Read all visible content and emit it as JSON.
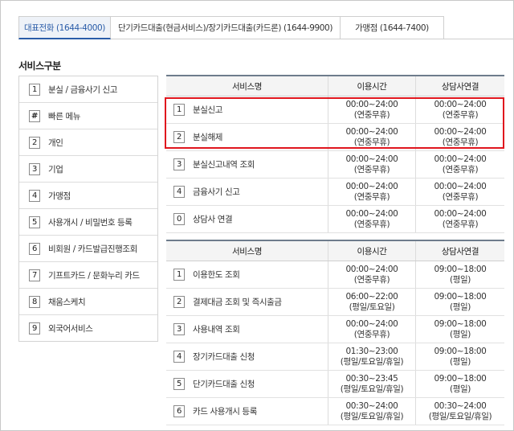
{
  "tabs": [
    {
      "label": "대표전화 (1644-4000)",
      "active": true
    },
    {
      "label": "단기카드대출(현금서비스)/장기카드대출(카드론) (1644-9900)",
      "active": false
    },
    {
      "label": "가맹점 (1644-7400)",
      "active": false
    }
  ],
  "section_title": "서비스구분",
  "menu": [
    {
      "key": "1",
      "label": "분실 / 금융사기 신고"
    },
    {
      "key": "#",
      "label": "빠른 메뉴"
    },
    {
      "key": "2",
      "label": "개인"
    },
    {
      "key": "3",
      "label": "기업"
    },
    {
      "key": "4",
      "label": "가맹점"
    },
    {
      "key": "5",
      "label": "사용개시 / 비밀번호 등록"
    },
    {
      "key": "6",
      "label": "비회원 / 카드발급진행조회"
    },
    {
      "key": "7",
      "label": "기프트카드 / 문화누리 카드"
    },
    {
      "key": "8",
      "label": "채움스케치"
    },
    {
      "key": "9",
      "label": "외국어서비스"
    }
  ],
  "table1": {
    "headers": [
      "서비스명",
      "이용시간",
      "상담사연결"
    ],
    "rows": [
      {
        "key": "1",
        "name": "분실신고",
        "hours": [
          "00:00~24:00",
          "(연중무휴)"
        ],
        "agent": [
          "00:00~24:00",
          "(연중무휴)"
        ]
      },
      {
        "key": "2",
        "name": "분실해제",
        "hours": [
          "00:00~24:00",
          "(연중무휴)"
        ],
        "agent": [
          "00:00~24:00",
          "(연중무휴)"
        ]
      },
      {
        "key": "3",
        "name": "분실신고내역 조회",
        "hours": [
          "00:00~24:00",
          "(연중무휴)"
        ],
        "agent": [
          "00:00~24:00",
          "(연중무휴)"
        ]
      },
      {
        "key": "4",
        "name": "금융사기 신고",
        "hours": [
          "00:00~24:00",
          "(연중무휴)"
        ],
        "agent": [
          "00:00~24:00",
          "(연중무휴)"
        ]
      },
      {
        "key": "0",
        "name": "상담사 연결",
        "hours": [
          "00:00~24:00",
          "(연중무휴)"
        ],
        "agent": [
          "00:00~24:00",
          "(연중무휴)"
        ]
      }
    ]
  },
  "table2": {
    "headers": [
      "서비스명",
      "이용시간",
      "상담사연결"
    ],
    "rows": [
      {
        "key": "1",
        "name": "이용한도 조회",
        "hours": [
          "00:00~24:00",
          "(연중무휴)"
        ],
        "agent": [
          "09:00~18:00",
          "(평일)"
        ]
      },
      {
        "key": "2",
        "name": "결제대금 조회 및 즉시출금",
        "hours": [
          "06:00~22:00",
          "(평일/토요일)"
        ],
        "agent": [
          "09:00~18:00",
          "(평일)"
        ]
      },
      {
        "key": "3",
        "name": "사용내역 조회",
        "hours": [
          "00:00~24:00",
          "(연중무휴)"
        ],
        "agent": [
          "09:00~18:00",
          "(평일)"
        ]
      },
      {
        "key": "4",
        "name": "장기카드대출 신청",
        "hours": [
          "01:30~23:00",
          "(평일/토요일/휴일)"
        ],
        "agent": [
          "09:00~18:00",
          "(평일)"
        ]
      },
      {
        "key": "5",
        "name": "단기카드대출 신청",
        "hours": [
          "00:30~23:45",
          "(평일/토요일/휴일)"
        ],
        "agent": [
          "09:00~18:00",
          "(평일)"
        ]
      },
      {
        "key": "6",
        "name": "카드 사용개시 등록",
        "hours": [
          "00:30~24:00",
          "(평일/토요일/휴일)"
        ],
        "agent": [
          "00:30~24:00",
          "(평일/토요일/휴일)"
        ]
      }
    ]
  },
  "colors": {
    "active_tab": "#2a5ca8",
    "highlight": "#e0161e",
    "header_rule": "#6e7c8c"
  }
}
